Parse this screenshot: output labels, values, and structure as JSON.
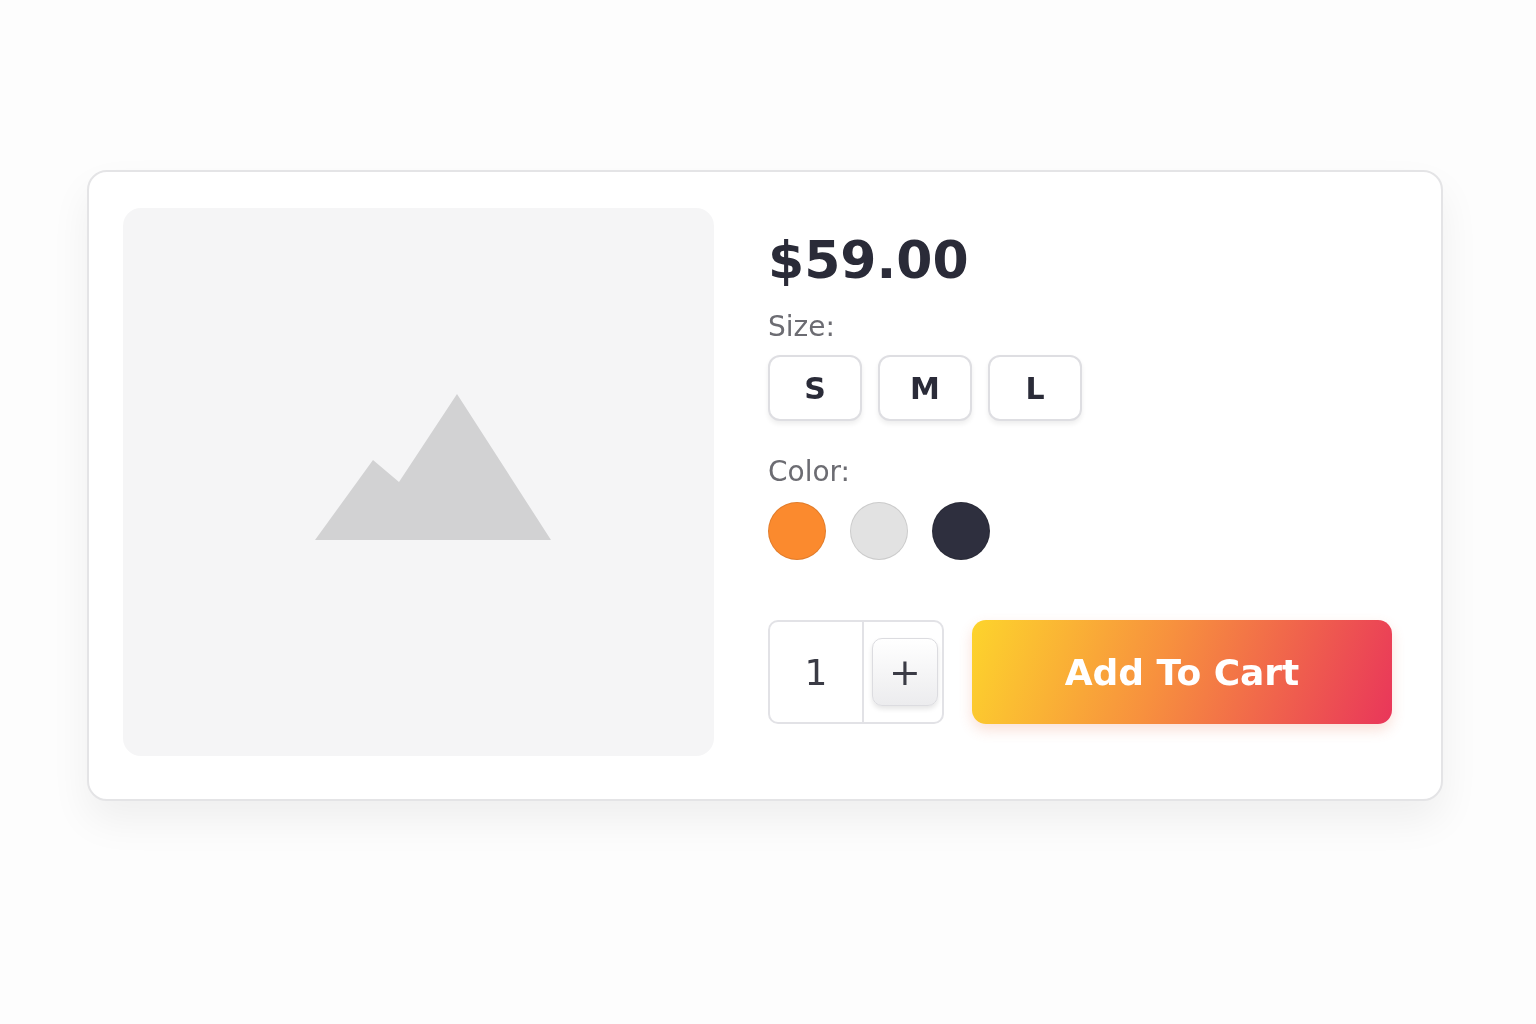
{
  "product": {
    "price": "$59.00",
    "size_label": "Size:",
    "sizes": [
      {
        "label": "S",
        "selected": false
      },
      {
        "label": "M",
        "selected": false
      },
      {
        "label": "L",
        "selected": false
      }
    ],
    "color_label": "Color:",
    "colors": [
      {
        "color": "#fb8a2e"
      },
      {
        "color": "#e2e2e2"
      },
      {
        "color": "#2e2f3e"
      }
    ],
    "quantity": "1",
    "increment": "+",
    "add_to_cart": "Add To Cart"
  }
}
